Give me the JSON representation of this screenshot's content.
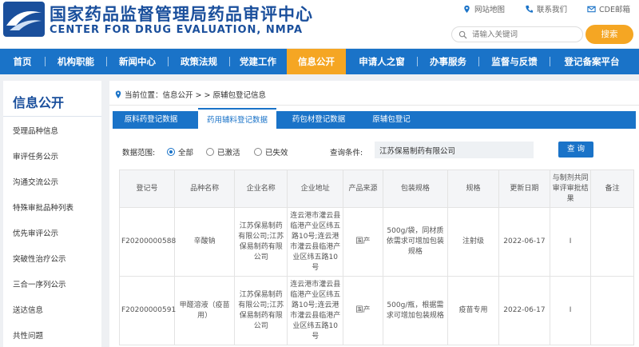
{
  "header": {
    "site_name_cn": "国家药品监督管理局药品审评中心",
    "site_name_en": "CENTER FOR DRUG EVALUATION, NMPA",
    "links": {
      "sitemap": "网站地图",
      "contact": "联系我们",
      "email": "CDE邮箱"
    },
    "search": {
      "placeholder": "请输入关键词",
      "button": "搜索"
    }
  },
  "nav": {
    "items": [
      "首页",
      "机构职能",
      "新闻中心",
      "政策法规",
      "党建工作",
      "信息公开",
      "申请人之窗",
      "办事服务",
      "监督与反馈",
      "登记备案平台"
    ],
    "active_index": 5
  },
  "sidebar": {
    "title": "信息公开",
    "items": [
      "受理品种信息",
      "审评任务公示",
      "沟通交流公示",
      "特殊审批品种列表",
      "优先审评公示",
      "突破性治疗公示",
      "三合一序列公示",
      "送达信息",
      "共性问题"
    ]
  },
  "breadcrumb": {
    "text": "当前位置：信息公开 > > 原辅包登记信息"
  },
  "tabs": {
    "items": [
      "原料药登记数据",
      "药用辅料登记数据",
      "药包材登记数据",
      "原辅包登记"
    ],
    "active_index": 1
  },
  "filter": {
    "scope_label": "数据范围:",
    "options": [
      "全部",
      "已激活",
      "已失效"
    ],
    "selected": "全部",
    "condition_label": "查询条件:",
    "condition_value": "江苏保易制药有限公司",
    "query_button": "查 询"
  },
  "table": {
    "headers": [
      "登记号",
      "品种名称",
      "企业名称",
      "企业地址",
      "产品来源",
      "包装规格",
      "规格",
      "更新日期",
      "与制剂共同审评审批结果",
      "备注"
    ],
    "rows": [
      [
        "F20200000588",
        "辛酸钠",
        "江苏保易制药有限公司;江苏保易制药有限公司",
        "连云港市灌云县临港产业区纬五路10号;连云港市灌云县临港产业区纬五路10号",
        "国产",
        "500g/袋，同材质依需求可增加包装规格",
        "注射级",
        "2022-06-17",
        "I",
        ""
      ],
      [
        "F20200000591",
        "甲醛溶液（疫苗用）",
        "江苏保易制药有限公司;江苏保易制药有限公司",
        "连云港市灌云县临港产业区纬五路10号;连云港市灌云县临港产业区纬五路10号",
        "国产",
        "500g/瓶，根据需求可增加包装规格",
        "疫苗专用",
        "2022-06-17",
        "I",
        ""
      ]
    ]
  },
  "colors": {
    "brand_blue": "#1a4f9c",
    "nav_blue": "#1a73c8",
    "accent_orange": "#f5a623"
  },
  "icons": {
    "sitemap": "location-pin-icon",
    "contact": "phone-icon",
    "email": "mail-icon",
    "search": "search-icon",
    "breadcrumb": "location-pin-icon"
  }
}
